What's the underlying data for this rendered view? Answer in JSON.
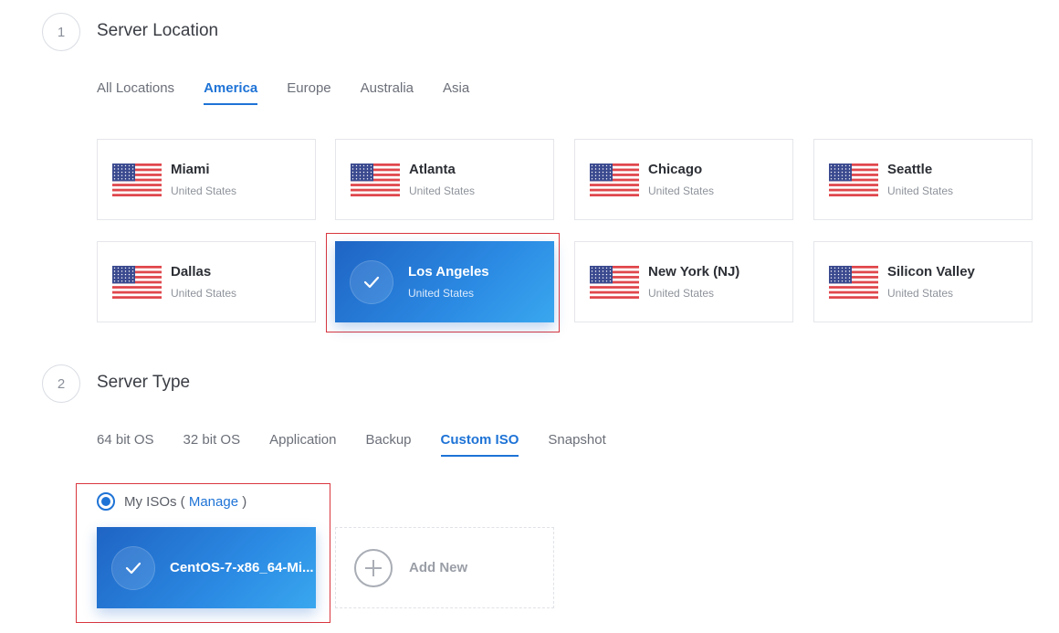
{
  "step1": {
    "number": "1",
    "title": "Server Location",
    "tabs": [
      {
        "label": "All Locations",
        "active": false
      },
      {
        "label": "America",
        "active": true
      },
      {
        "label": "Europe",
        "active": false
      },
      {
        "label": "Australia",
        "active": false
      },
      {
        "label": "Asia",
        "active": false
      }
    ],
    "locations": [
      {
        "name": "Miami",
        "country": "United States",
        "flag": "us-flag-icon",
        "selected": false
      },
      {
        "name": "Atlanta",
        "country": "United States",
        "flag": "us-flag-icon",
        "selected": false
      },
      {
        "name": "Chicago",
        "country": "United States",
        "flag": "us-flag-icon",
        "selected": false
      },
      {
        "name": "Seattle",
        "country": "United States",
        "flag": "us-flag-icon",
        "selected": false
      },
      {
        "name": "Dallas",
        "country": "United States",
        "flag": "us-flag-icon",
        "selected": false
      },
      {
        "name": "Los Angeles",
        "country": "United States",
        "flag": "us-flag-icon",
        "selected": true
      },
      {
        "name": "New York (NJ)",
        "country": "United States",
        "flag": "us-flag-icon",
        "selected": false
      },
      {
        "name": "Silicon Valley",
        "country": "United States",
        "flag": "us-flag-icon",
        "selected": false
      }
    ]
  },
  "step2": {
    "number": "2",
    "title": "Server Type",
    "tabs": [
      {
        "label": "64 bit OS",
        "active": false
      },
      {
        "label": "32 bit OS",
        "active": false
      },
      {
        "label": "Application",
        "active": false
      },
      {
        "label": "Backup",
        "active": false
      },
      {
        "label": "Custom ISO",
        "active": true
      },
      {
        "label": "Snapshot",
        "active": false
      }
    ],
    "iso_radio": {
      "label_prefix": "My ISOs (",
      "manage_link": "Manage",
      "label_suffix": ")",
      "checked": true
    },
    "iso_card": {
      "name": "CentOS-7-x86_64-Mi...",
      "selected": true
    },
    "add_new": {
      "label": "Add New",
      "icon": "plus-circle-icon"
    }
  },
  "colors": {
    "accent": "#1e73d6",
    "selected_gradient_start": "#1f64c4",
    "selected_gradient_end": "#39a7ef",
    "highlight_border": "#d9363e"
  }
}
